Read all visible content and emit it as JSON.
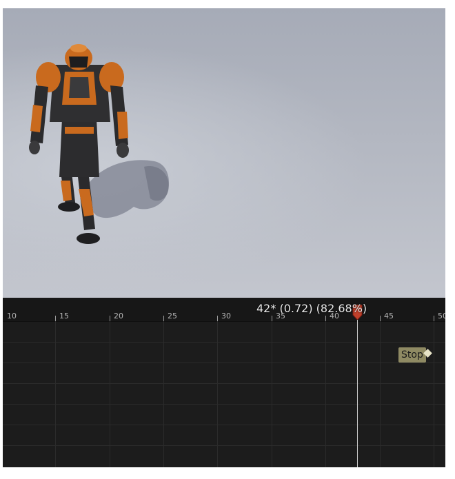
{
  "timeline": {
    "ruler_labels": [
      "10",
      "15",
      "20",
      "25",
      "30",
      "35",
      "40",
      "45",
      "50"
    ],
    "playhead_readout": "42* (0.72) (82.68%)",
    "playhead_frame": 42,
    "notify_marker_label": "Stop"
  },
  "colors": {
    "viewport_bg": "#b3b7c1",
    "timeline_bg": "#1c1c1c",
    "playhead_handle": "#c0402b",
    "armor_orange": "#c96a1e"
  }
}
